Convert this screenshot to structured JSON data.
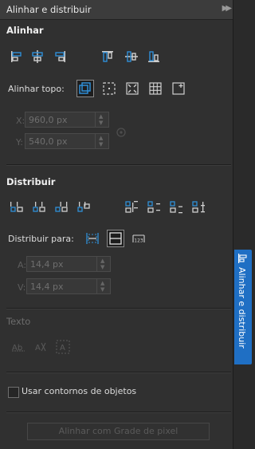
{
  "panel": {
    "title": "Alinhar e distribuir"
  },
  "align": {
    "section_title": "Alinhar",
    "buttons": [
      "align-left-icon",
      "align-center-h-icon",
      "align-right-icon",
      "align-top-icon",
      "align-center-v-icon",
      "align-bottom-icon"
    ],
    "align_to_label": "Alinhar topo:",
    "align_to_options": [
      "active-objects-icon",
      "page-edge-icon",
      "page-center-icon",
      "grid-icon",
      "specified-point-icon"
    ],
    "x_label": "X:",
    "x_value": "960,0 px",
    "y_label": "Y:",
    "y_value": "540,0 px"
  },
  "distribute": {
    "section_title": "Distribuir",
    "buttons": [
      "dist-left-icon",
      "dist-center-h-icon",
      "dist-spacing-h-icon",
      "dist-right-icon",
      "dist-top-icon",
      "dist-center-v-icon",
      "dist-spacing-v-icon",
      "dist-bottom-icon"
    ],
    "distribute_to_label": "Distribuir para:",
    "distribute_to_options": [
      "selection-extent-icon",
      "page-extent-icon",
      "spacing-icon"
    ],
    "a_label": "A:",
    "a_value": "14,4 px",
    "v_label": "V:",
    "v_value": "14,4 px"
  },
  "text": {
    "section_title": "Texto",
    "buttons": [
      "text-first-baseline-icon",
      "text-last-baseline-icon",
      "text-bbox-icon"
    ]
  },
  "outlines": {
    "label": "Usar contornos de objetos",
    "checked": false
  },
  "pixel_grid_button": "Alinhar com Grade de pixel",
  "side_tab": {
    "label": "Alinhar e distribuir"
  },
  "colors": {
    "accent": "#1f6fc4",
    "panel": "#303030",
    "active_icon": "#2f8fd8"
  }
}
